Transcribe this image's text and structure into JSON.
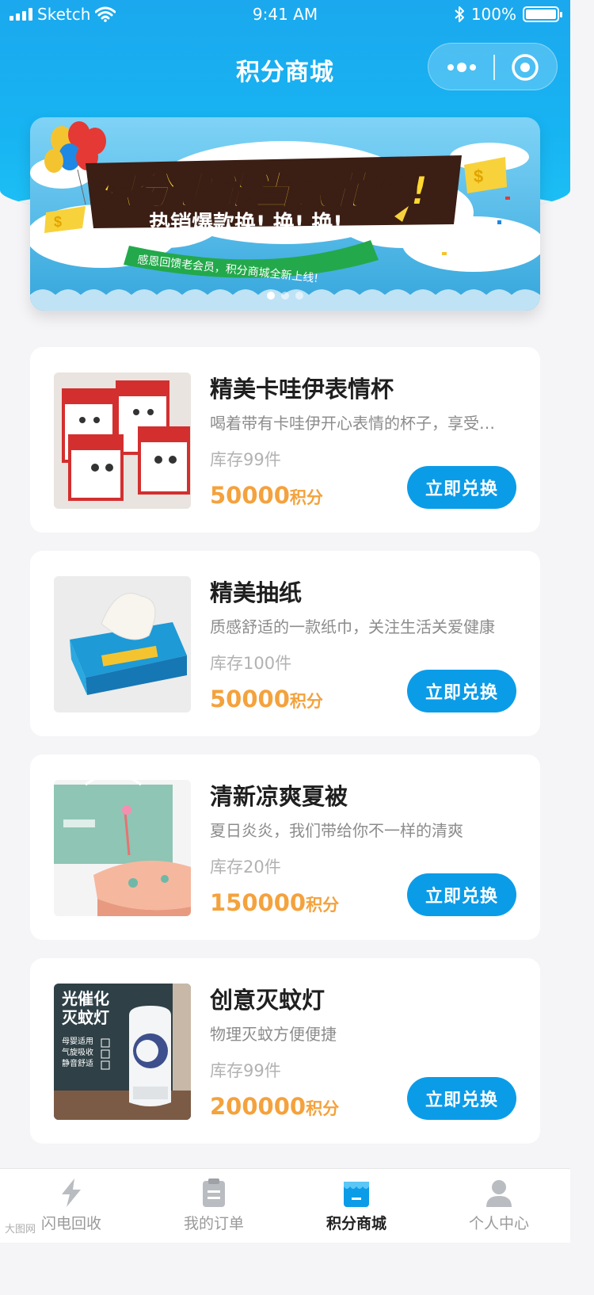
{
  "status_bar": {
    "carrier": "Sketch",
    "time": "9:41 AM",
    "battery": "100%"
  },
  "nav": {
    "title": "积分商城"
  },
  "banner": {
    "headline": "积分也能当钱花啦!",
    "subheadline": "热销爆款换! 换! 换!",
    "ribbon": "感恩回馈老会员，积分商城全新上线!",
    "slide_count": 3,
    "active_slide": 1
  },
  "products": [
    {
      "name": "精美卡哇伊表情杯",
      "desc": "喝着带有卡哇伊开心表情的杯子，享受…",
      "stock": "库存99件",
      "price": "50000",
      "unit": "积分",
      "button": "立即兑换",
      "image": "mug-gift-box"
    },
    {
      "name": "精美抽纸",
      "desc": "质感舒适的一款纸巾，关注生活关爱健康",
      "stock": "库存100件",
      "price": "50000",
      "unit": "积分",
      "button": "立即兑换",
      "image": "tissue-box"
    },
    {
      "name": "清新凉爽夏被",
      "desc": "夏日炎炎，我们带给你不一样的清爽",
      "stock": "库存20件",
      "price": "150000",
      "unit": "积分",
      "button": "立即兑换",
      "image": "summer-quilt"
    },
    {
      "name": "创意灭蚊灯",
      "desc": "物理灭蚊方便便捷",
      "stock": "库存99件",
      "price": "200000",
      "unit": "积分",
      "button": "立即兑换",
      "image": "mosquito-lamp",
      "image_text": {
        "title_line1": "光催化",
        "title_line2": "灭蚊灯",
        "feature1": "母婴适用",
        "feature2": "气旋吸收",
        "feature3": "静音舒适"
      }
    }
  ],
  "tab_bar": {
    "items": [
      {
        "label": "闪电回收",
        "icon": "lightning-icon",
        "active": false
      },
      {
        "label": "我的订单",
        "icon": "clipboard-icon",
        "active": false
      },
      {
        "label": "积分商城",
        "icon": "store-icon",
        "active": true
      },
      {
        "label": "个人中心",
        "icon": "person-icon",
        "active": false
      }
    ]
  },
  "watermark": "大图网",
  "colors": {
    "brand_blue": "#0b9ce8",
    "price_orange": "#f4a23d",
    "header_gradient_top": "#1ba8ee"
  }
}
